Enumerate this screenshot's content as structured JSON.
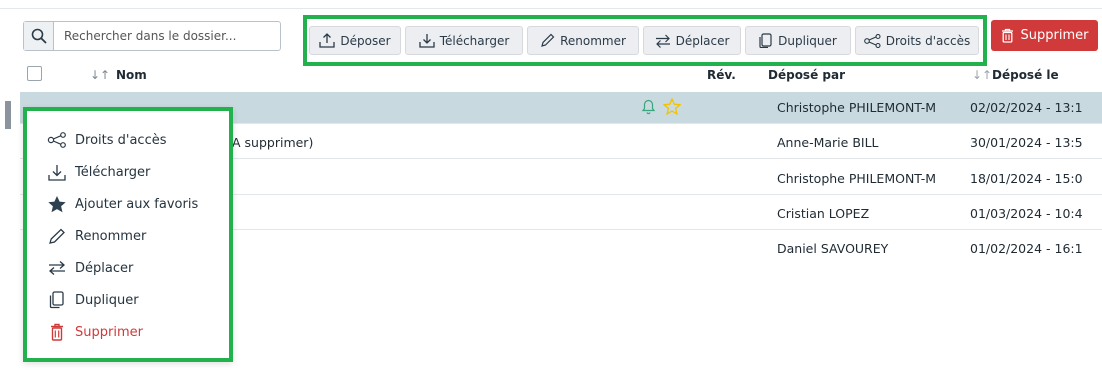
{
  "search": {
    "placeholder": "Rechercher dans le dossier..."
  },
  "toolbar": {
    "buttons": [
      {
        "label": "Déposer",
        "icon": "upload-icon"
      },
      {
        "label": "Télécharger",
        "icon": "download-icon"
      },
      {
        "label": "Renommer",
        "icon": "pencil-icon"
      },
      {
        "label": "Déplacer",
        "icon": "move-arrows-icon"
      },
      {
        "label": "Dupliquer",
        "icon": "copy-icon"
      },
      {
        "label": "Droits d'accès",
        "icon": "share-icon"
      }
    ],
    "delete_label": "Supprimer"
  },
  "table": {
    "headers": {
      "name": "Nom",
      "rev": "Rév.",
      "deposited_by": "Déposé par",
      "deposited_on": "Déposé le"
    },
    "rows": [
      {
        "name": "",
        "deposited_by": "Christophe PHILEMONT-M",
        "date": "02/02/2024 - 13:1",
        "selected": true
      },
      {
        "name": "A supprimer)",
        "deposited_by": "Anne-Marie BILL",
        "date": "30/01/2024 - 13:5"
      },
      {
        "name": "",
        "deposited_by": "Christophe PHILEMONT-M",
        "date": "18/01/2024 - 15:0"
      },
      {
        "name": "",
        "deposited_by": "Cristian LOPEZ",
        "date": "01/03/2024 - 10:4"
      },
      {
        "name": "",
        "deposited_by": "Daniel SAVOUREY",
        "date": "01/02/2024 - 16:1"
      }
    ]
  },
  "context_menu": {
    "items": [
      {
        "label": "Droits d'accès",
        "icon": "share-icon"
      },
      {
        "label": "Télécharger",
        "icon": "download-icon"
      },
      {
        "label": "Ajouter aux favoris",
        "icon": "star-icon"
      },
      {
        "label": "Renommer",
        "icon": "pencil-icon"
      },
      {
        "label": "Déplacer",
        "icon": "move-arrows-icon"
      },
      {
        "label": "Dupliquer",
        "icon": "copy-icon"
      },
      {
        "label": "Supprimer",
        "icon": "trash-icon"
      }
    ]
  },
  "colors": {
    "highlight": "#22b14c",
    "danger": "#d13a3a",
    "selected_row": "#c8dadf",
    "star": "#f2c200",
    "bell": "#3aa57a"
  }
}
